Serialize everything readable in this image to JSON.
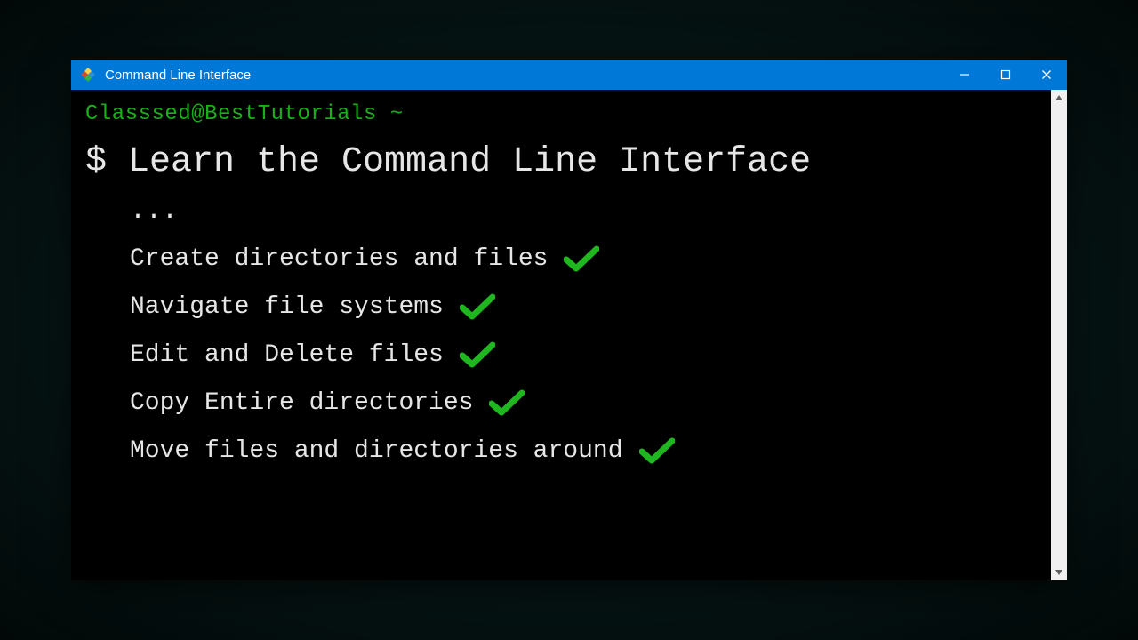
{
  "window": {
    "title": "Command Line Interface"
  },
  "terminal": {
    "prompt": "Classsed@BestTutorials  ~",
    "heading": "$ Learn the Command Line Interface",
    "ellipsis": "...",
    "items": [
      "Create directories and files",
      "Navigate file systems",
      "Edit and Delete files",
      "Copy Entire directories",
      "Move files and directories around"
    ]
  },
  "colors": {
    "titlebar": "#0078d7",
    "prompt_green": "#18b218",
    "check_green": "#1fb61f"
  }
}
